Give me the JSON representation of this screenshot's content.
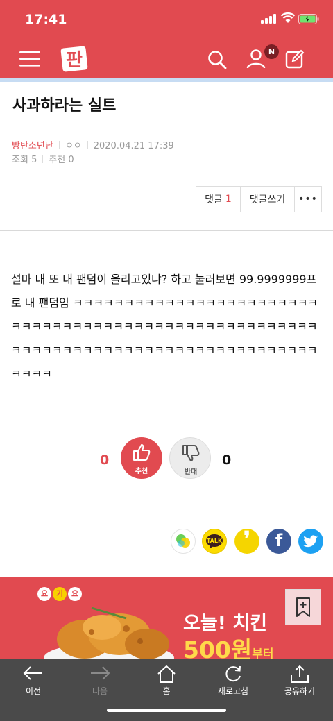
{
  "status": {
    "time": "17:41"
  },
  "appbar": {
    "logo_text": "판",
    "badge": "N",
    "brand_color": "#e14a50"
  },
  "post": {
    "title": "사과하라는 실트",
    "author": "방탄소년단",
    "nick": "ㅇㅇ",
    "date": "2020.04.21 17:39",
    "views_label": "조회",
    "views": "5",
    "recommend_label": "추천",
    "recommend": "0",
    "body": "설마 내 또 내 팬덤이 올리고있냐? 하고 눌러보면 99.9999999프로 내 팬덤임 ㅋㅋㅋㅋㅋㅋㅋㅋㅋㅋㅋㅋㅋㅋㅋㅋㅋㅋㅋㅋㅋㅋㅋㅋㅋㅋㅋㅋㅋㅋㅋㅋㅋㅋㅋㅋㅋㅋㅋㅋㅋㅋㅋㅋㅋㅋㅋㅋㅋㅋㅋㅋㅋㅋㅋㅋㅋㅋㅋㅋㅋㅋㅋㅋㅋㅋㅋㅋㅋㅋㅋㅋㅋㅋㅋㅋㅋㅋㅋㅋㅋㅋㅋㅋㅋㅋㅋㅋ"
  },
  "actions": {
    "comment_label": "댓글",
    "comment_count": "1",
    "write_comment": "댓글쓰기",
    "more": "•••"
  },
  "vote": {
    "up_count": "0",
    "up_label": "추천",
    "down_count": "0",
    "down_label": "반대"
  },
  "share": {
    "talk": "TALK",
    "story": "❜",
    "facebook": "f"
  },
  "ad": {
    "brand_chars": [
      "요",
      "기",
      "요"
    ],
    "line1": "오늘! 치킨",
    "line2_num": "500원",
    "line2_suffix": "부터"
  },
  "bottom_nav": [
    {
      "label": "이전",
      "icon": "arrow-left-icon"
    },
    {
      "label": "다음",
      "icon": "arrow-right-icon"
    },
    {
      "label": "홈",
      "icon": "home-icon"
    },
    {
      "label": "새로고침",
      "icon": "refresh-icon"
    },
    {
      "label": "공유하기",
      "icon": "share-icon"
    }
  ]
}
